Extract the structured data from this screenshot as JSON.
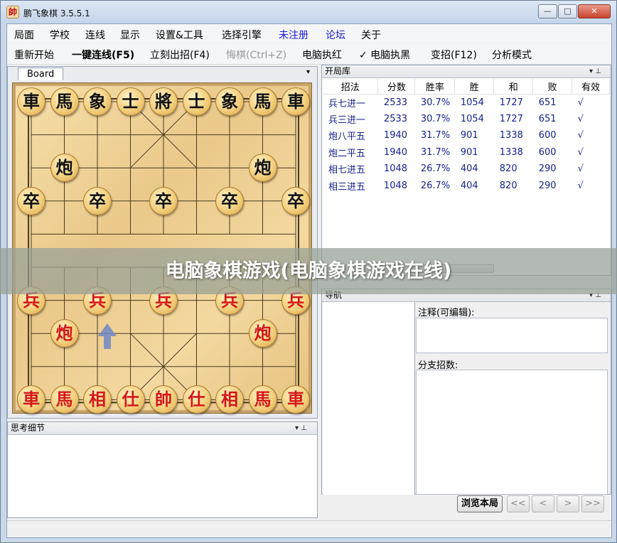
{
  "window": {
    "title": "鹏飞象棋 3.5.5.1",
    "app_icon_char": "帥",
    "controls": {
      "minimize": "—",
      "maximize": "□",
      "close": "✕"
    }
  },
  "menu": [
    {
      "label": "局面",
      "blue": false
    },
    {
      "label": "学校",
      "blue": false
    },
    {
      "label": "连线",
      "blue": false
    },
    {
      "label": "显示",
      "blue": false
    },
    {
      "label": "设置&工具",
      "blue": false
    },
    {
      "label": "选择引擎",
      "blue": false
    },
    {
      "label": "未注册",
      "blue": true
    },
    {
      "label": "论坛",
      "blue": true
    },
    {
      "label": "关于",
      "blue": false
    }
  ],
  "toolbar": [
    {
      "label": "重新开始",
      "style": "normal"
    },
    {
      "label": "一键连线(F5)",
      "style": "bold"
    },
    {
      "label": "立刻出招(F4)",
      "style": "normal"
    },
    {
      "label": "悔棋(Ctrl+Z)",
      "style": "disabled"
    },
    {
      "label": "电脑执红",
      "style": "normal"
    },
    {
      "label": "✓  电脑执黑",
      "style": "normal"
    },
    {
      "label": "变招(F12)",
      "style": "normal"
    },
    {
      "label": "分析模式",
      "style": "normal"
    }
  ],
  "board_panel": {
    "tab_label": "Board",
    "menu_glyph": "▾",
    "pieces": [
      {
        "char": "車",
        "side": "black",
        "file": 0,
        "rank": 0
      },
      {
        "char": "馬",
        "side": "black",
        "file": 1,
        "rank": 0
      },
      {
        "char": "象",
        "side": "black",
        "file": 2,
        "rank": 0
      },
      {
        "char": "士",
        "side": "black",
        "file": 3,
        "rank": 0
      },
      {
        "char": "將",
        "side": "black",
        "file": 4,
        "rank": 0
      },
      {
        "char": "士",
        "side": "black",
        "file": 5,
        "rank": 0
      },
      {
        "char": "象",
        "side": "black",
        "file": 6,
        "rank": 0
      },
      {
        "char": "馬",
        "side": "black",
        "file": 7,
        "rank": 0
      },
      {
        "char": "車",
        "side": "black",
        "file": 8,
        "rank": 0
      },
      {
        "char": "炮",
        "side": "black",
        "file": 1,
        "rank": 2
      },
      {
        "char": "炮",
        "side": "black",
        "file": 7,
        "rank": 2
      },
      {
        "char": "卒",
        "side": "black",
        "file": 0,
        "rank": 3
      },
      {
        "char": "卒",
        "side": "black",
        "file": 2,
        "rank": 3
      },
      {
        "char": "卒",
        "side": "black",
        "file": 4,
        "rank": 3
      },
      {
        "char": "卒",
        "side": "black",
        "file": 6,
        "rank": 3
      },
      {
        "char": "卒",
        "side": "black",
        "file": 8,
        "rank": 3
      },
      {
        "char": "兵",
        "side": "red",
        "file": 0,
        "rank": 6
      },
      {
        "char": "兵",
        "side": "red",
        "file": 2,
        "rank": 6
      },
      {
        "char": "兵",
        "side": "red",
        "file": 4,
        "rank": 6
      },
      {
        "char": "兵",
        "side": "red",
        "file": 6,
        "rank": 6
      },
      {
        "char": "兵",
        "side": "red",
        "file": 8,
        "rank": 6
      },
      {
        "char": "炮",
        "side": "red",
        "file": 1,
        "rank": 7
      },
      {
        "char": "炮",
        "side": "red",
        "file": 7,
        "rank": 7
      },
      {
        "char": "車",
        "side": "red",
        "file": 0,
        "rank": 9
      },
      {
        "char": "馬",
        "side": "red",
        "file": 1,
        "rank": 9
      },
      {
        "char": "相",
        "side": "red",
        "file": 2,
        "rank": 9
      },
      {
        "char": "仕",
        "side": "red",
        "file": 3,
        "rank": 9
      },
      {
        "char": "帥",
        "side": "red",
        "file": 4,
        "rank": 9
      },
      {
        "char": "仕",
        "side": "red",
        "file": 5,
        "rank": 9
      },
      {
        "char": "相",
        "side": "red",
        "file": 6,
        "rank": 9
      },
      {
        "char": "馬",
        "side": "red",
        "file": 7,
        "rank": 9
      },
      {
        "char": "車",
        "side": "red",
        "file": 8,
        "rank": 9
      }
    ]
  },
  "thinking_panel": {
    "title": "思考细节",
    "controls": "▾ ⊥"
  },
  "opening_book": {
    "title": "开局库",
    "controls": "▾ ⊥",
    "columns": [
      "招法",
      "分数",
      "胜率",
      "胜",
      "和",
      "败",
      "有效"
    ],
    "rows": [
      [
        "兵七进一",
        "2533",
        "30.7%",
        "1054",
        "1727",
        "651",
        "√"
      ],
      [
        "兵三进一",
        "2533",
        "30.7%",
        "1054",
        "1727",
        "651",
        "√"
      ],
      [
        "炮八平五",
        "1940",
        "31.7%",
        "901",
        "1338",
        "600",
        "√"
      ],
      [
        "炮二平五",
        "1940",
        "31.7%",
        "901",
        "1338",
        "600",
        "√"
      ],
      [
        "相七进五",
        "1048",
        "26.7%",
        "404",
        "820",
        "290",
        "√"
      ],
      [
        "相三进五",
        "1048",
        "26.7%",
        "404",
        "820",
        "290",
        "√"
      ]
    ]
  },
  "navigation": {
    "title": "导航",
    "controls": "▾ ⊥",
    "comment_label": "注释(可编辑):",
    "branch_label": "分支招数:",
    "browse_button": "浏览本局",
    "first_button": "<<",
    "prev_button": "<",
    "next_button": ">",
    "last_button": ">>"
  },
  "banner": {
    "text": "电脑象棋游戏(电脑象棋游戏在线)"
  }
}
